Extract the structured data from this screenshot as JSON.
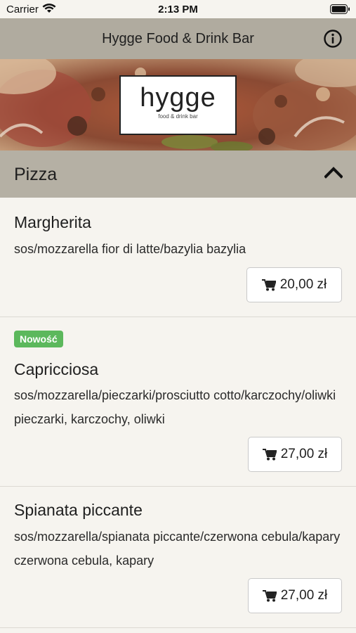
{
  "status_bar": {
    "carrier": "Carrier",
    "time": "2:13 PM"
  },
  "nav": {
    "title": "Hygge Food & Drink Bar"
  },
  "logo": {
    "word": "hygge",
    "sub": "food & drink bar"
  },
  "category": {
    "title": "Pizza"
  },
  "items": [
    {
      "name": "Margherita",
      "description": "sos/mozzarella fior di latte/bazylia bazylia",
      "price": "20,00 zł",
      "badge": ""
    },
    {
      "name": "Capricciosa",
      "description": "sos/mozzarella/pieczarki/prosciutto cotto/karczochy/oliwki pieczarki, karczochy, oliwki",
      "price": "27,00 zł",
      "badge": "Nowość"
    },
    {
      "name": "Spianata piccante",
      "description": "sos/mozzarella/spianata piccante/czerwona cebula/kapary czerwona cebula, kapary",
      "price": "27,00 zł",
      "badge": ""
    }
  ],
  "colors": {
    "nav_bg": "#b0ab9f",
    "category_bg": "#b5b0a4",
    "badge_green": "#5cb85c",
    "page_bg": "#f6f4ef"
  },
  "icons": [
    "wifi-icon",
    "battery-icon",
    "info-icon",
    "chevron-up-icon",
    "cart-icon"
  ]
}
